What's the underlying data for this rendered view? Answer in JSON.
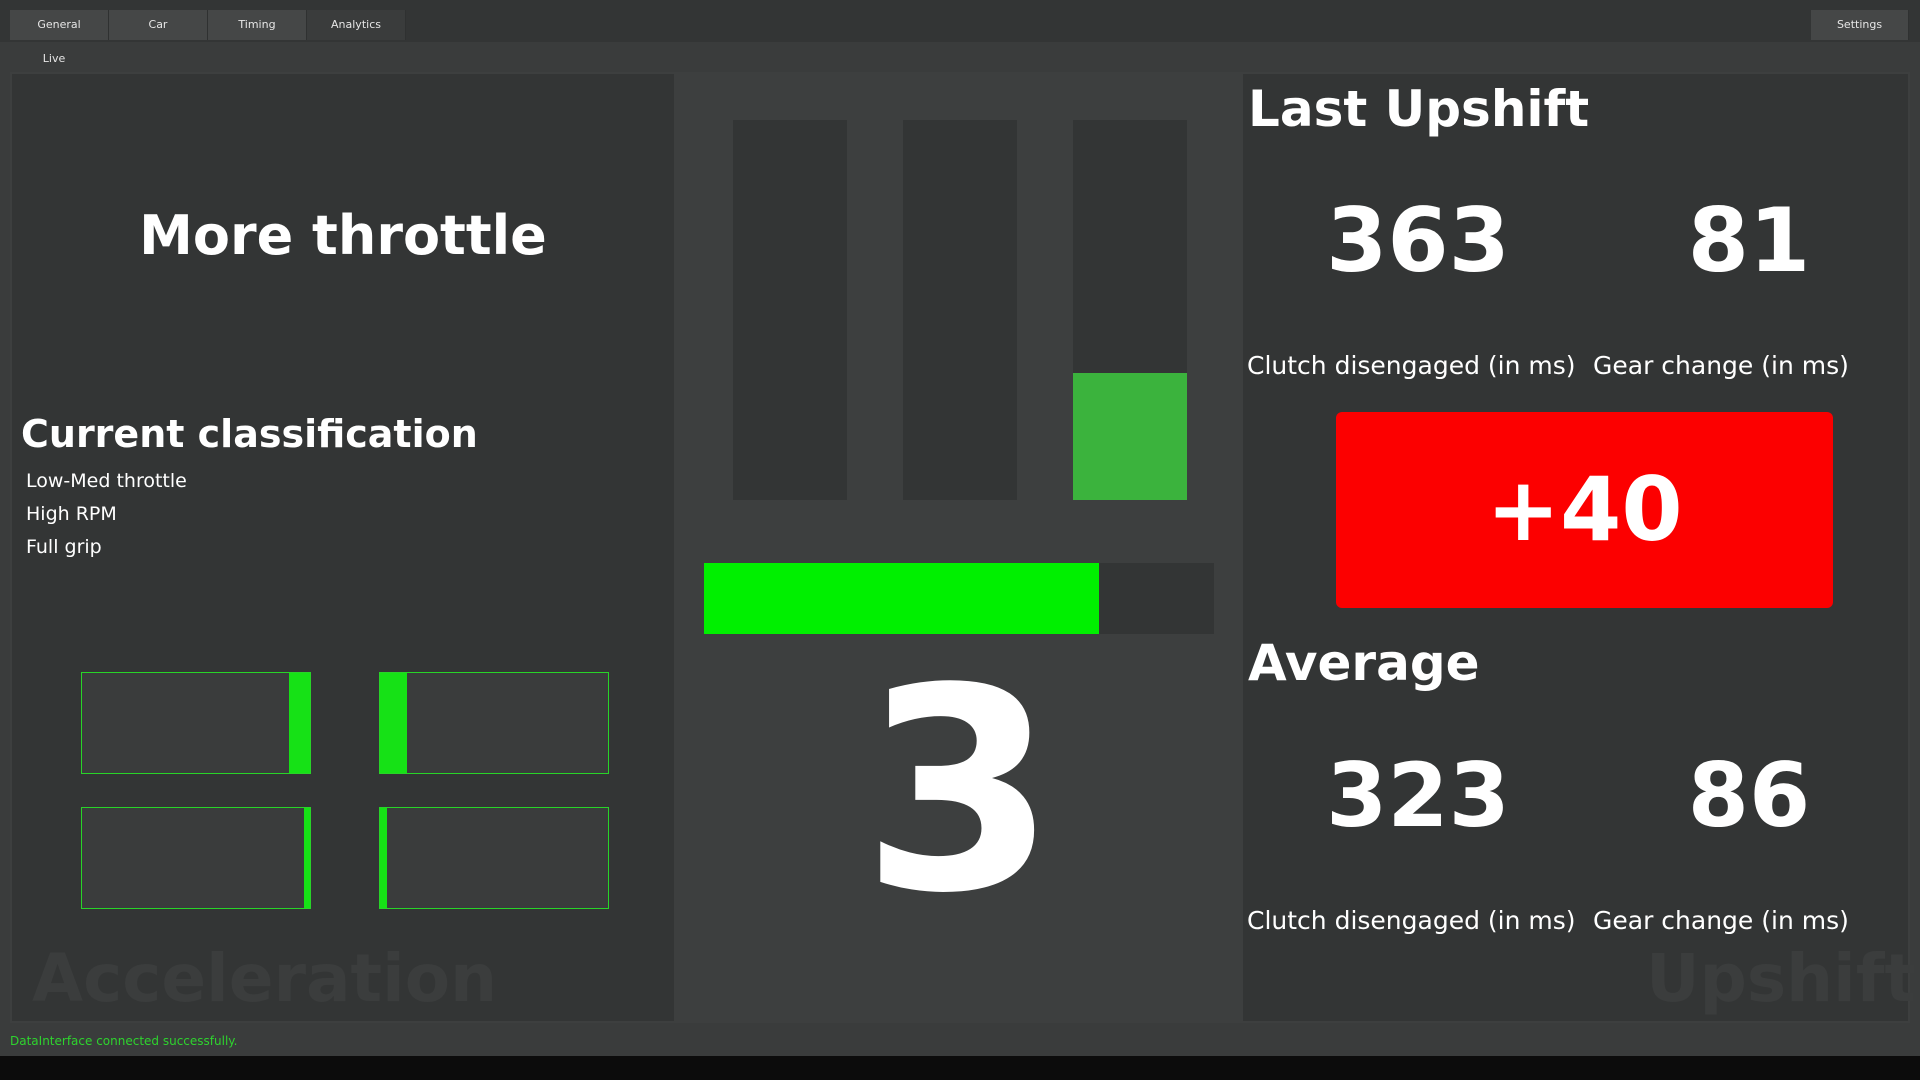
{
  "tabs": [
    {
      "label": "General"
    },
    {
      "label": "Car"
    },
    {
      "label": "Timing"
    },
    {
      "label": "Analytics"
    }
  ],
  "settings_label": "Settings",
  "subtab_label": "Live",
  "acceleration": {
    "advice": "More throttle",
    "classification_title": "Current classification",
    "classification_items": [
      "Low-Med throttle",
      "High RPM",
      "Full grip"
    ],
    "wheel_slip": [
      {
        "side": "right",
        "fraction": 0.09
      },
      {
        "side": "left",
        "fraction": 0.12
      },
      {
        "side": "right",
        "fraction": 0.025
      },
      {
        "side": "left",
        "fraction": 0.03
      }
    ],
    "watermark": "Acceleration"
  },
  "center": {
    "vertical_bars": [
      0.0,
      0.0,
      0.335
    ],
    "horizontal_bar": 0.775,
    "gear": "3"
  },
  "upshift": {
    "last_title": "Last Upshift",
    "last_clutch": "363",
    "last_gear_change": "81",
    "clutch_label": "Clutch disengaged (in ms)",
    "gear_change_label": "Gear change (in ms)",
    "delta": "+40",
    "delta_color": "#fc0000",
    "avg_title": "Average",
    "avg_clutch": "323",
    "avg_gear_change": "86",
    "watermark": "Upshift"
  },
  "status": "DataInterface connected successfully.",
  "colors": {
    "accent_green": "#16e116",
    "bar_green": "#3bb33d",
    "status_green": "#2ed32e"
  }
}
